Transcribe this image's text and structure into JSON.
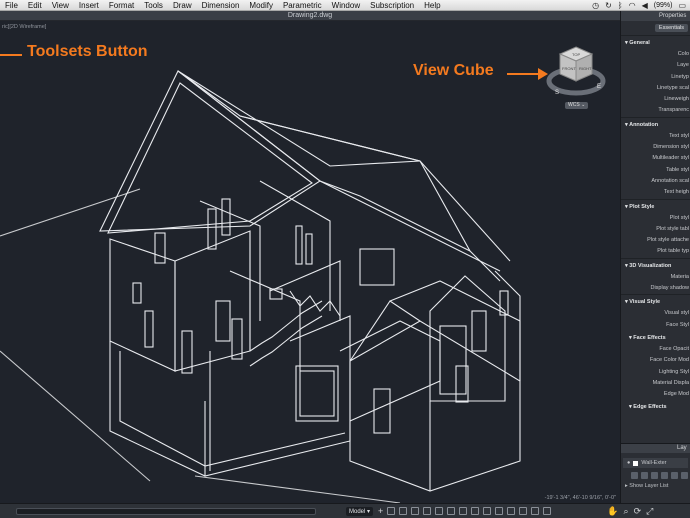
{
  "menubar": {
    "items": [
      "File",
      "Edit",
      "View",
      "Insert",
      "Format",
      "Tools",
      "Draw",
      "Dimension",
      "Modify",
      "Parametric",
      "Window",
      "Subscription",
      "Help"
    ],
    "battery_label": "(99%)"
  },
  "drawing": {
    "title": "Drawing2.dwg",
    "viewport_label": "ric][2D Wireframe]",
    "coordinates": "-19'-1 3/4\", 46'-10 9/16\", 0'-0\""
  },
  "annotations": {
    "toolsets_callout": "Toolsets Button",
    "viewcube_callout": "View Cube",
    "color": "#f47a1f"
  },
  "viewcube": {
    "top": "TOP",
    "front": "FRONT",
    "right": "RIGHT",
    "compass_s": "S",
    "compass_e": "E",
    "wcs": "WCS"
  },
  "properties": {
    "header": "Properties",
    "tab": "Essentials",
    "sections": {
      "general": "General",
      "annotation": "Annotation",
      "plot_style": "Plot Style",
      "visualization": "3D Visualization",
      "visual_style": "Visual Style",
      "face_effects": "Face Effects",
      "edge_effects": "Edge Effects"
    },
    "general_rows": [
      "Colo",
      "Laye",
      "Linetyp",
      "Linetype scal",
      "Lineweigh",
      "Transparenc"
    ],
    "annotation_rows": [
      "Text styl",
      "Dimension styl",
      "Multileader styl",
      "Table styl",
      "Annotation scal",
      "Text heigh"
    ],
    "plot_rows": [
      "Plot styl",
      "Plot style tabl",
      "Plot style attache",
      "Plot table typ"
    ],
    "visualization_rows": [
      "Materia",
      "Display shadow"
    ],
    "visual_style_rows": [
      "Visual styl",
      "Face Styl"
    ],
    "face_effects_rows": [
      "Face Opacit",
      "Face Color Mod",
      "Lighting Styl",
      "Material Displa",
      "Edge Mod"
    ]
  },
  "layers": {
    "header": "Lay",
    "current_layer": "Wall-Exter",
    "show_list": "Show Layer List"
  },
  "statusbar": {
    "model": "Model"
  }
}
